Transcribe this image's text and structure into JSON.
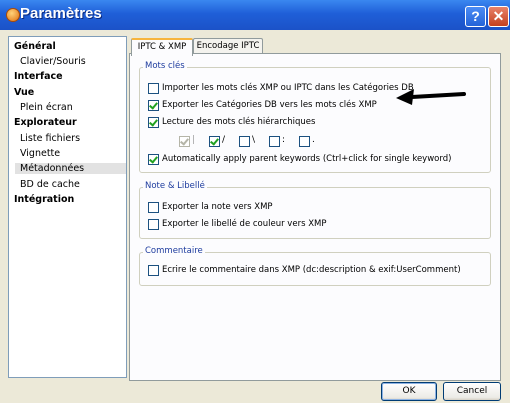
{
  "window": {
    "title": "Paramètres",
    "help_label": "?",
    "close_label": "✕"
  },
  "sidebar": {
    "items": [
      {
        "label": "Général",
        "level": 0
      },
      {
        "label": "Clavier/Souris",
        "level": 1
      },
      {
        "label": "Interface",
        "level": 0
      },
      {
        "label": "Vue",
        "level": 0
      },
      {
        "label": "Plein écran",
        "level": 1
      },
      {
        "label": "Explorateur",
        "level": 0
      },
      {
        "label": "Liste fichiers",
        "level": 1
      },
      {
        "label": "Vignette",
        "level": 1
      },
      {
        "label": "Métadonnées",
        "level": 1,
        "selected": true
      },
      {
        "label": "BD de cache",
        "level": 1
      },
      {
        "label": "Intégration",
        "level": 0
      }
    ]
  },
  "tabs": [
    {
      "label": "IPTC & XMP",
      "active": true
    },
    {
      "label": "Encodage IPTC",
      "active": false
    }
  ],
  "groups": {
    "mots_cles": {
      "label": "Mots clés",
      "items": [
        {
          "label": "Importer les mots clés XMP ou IPTC dans les Catégories DB",
          "checked": false
        },
        {
          "label": "Exporter les Catégories DB vers les mots clés XMP",
          "checked": true
        },
        {
          "label": "Lecture des mots clés hiérarchiques",
          "checked": true
        }
      ],
      "separators": [
        {
          "symbol": "|",
          "checked": true,
          "disabled": true
        },
        {
          "symbol": "/",
          "checked": true,
          "disabled": false
        },
        {
          "symbol": "\\",
          "checked": false,
          "disabled": false
        },
        {
          "symbol": ":",
          "checked": false,
          "disabled": false
        },
        {
          "symbol": ".",
          "checked": false,
          "disabled": false
        }
      ],
      "auto_apply": {
        "label": "Automatically apply parent keywords (Ctrl+click for single keyword)",
        "checked": true
      }
    },
    "note": {
      "label": "Note & Libellé",
      "items": [
        {
          "label": "Exporter la note vers XMP",
          "checked": false
        },
        {
          "label": "Exporter le libellé de couleur vers XMP",
          "checked": false
        }
      ]
    },
    "commentaire": {
      "label": "Commentaire",
      "items": [
        {
          "label": "Ecrire le commentaire dans XMP (dc:description & exif:UserComment)",
          "checked": false
        }
      ]
    }
  },
  "buttons": {
    "ok": "OK",
    "cancel": "Cancel"
  },
  "colors": {
    "titlebar": "#1f5fd8",
    "group_label": "#1e3c9e",
    "check": "#21a121",
    "active_tab_accent": "#f7b43c"
  }
}
